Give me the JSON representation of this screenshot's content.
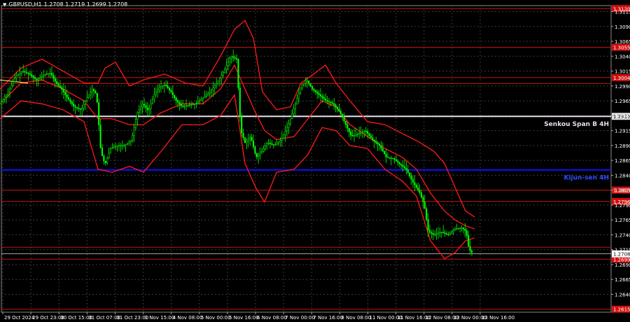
{
  "header": {
    "symbol_label": "GBPUSD,H1",
    "ohlc": "1.2708 1.2719 1.2699 1.2708"
  },
  "colors": {
    "background": "#000000",
    "grid": "#3a3a3a",
    "candle_bull": "#00ff00",
    "candle_bear": "#00ff00",
    "band": "#ff1a1a",
    "level_red": "#c0170b",
    "senkou": "#e6dde6",
    "kijun": "#1010ff",
    "price_line": "#ffffff",
    "axis_text": "#ffffff"
  },
  "chart_data": {
    "type": "candlestick",
    "title": "GBPUSD,H1",
    "ylim": [
      1.261,
      1.3125
    ],
    "y_ticks": [
      "1.3115",
      "1.3090",
      "1.3065",
      "1.3040",
      "1.3015",
      "1.2990",
      "1.2965",
      "1.2940",
      "1.2915",
      "1.2890",
      "1.2865",
      "1.2840",
      "1.2815",
      "1.2790",
      "1.2765",
      "1.2740",
      "1.2715",
      "1.2690",
      "1.2665",
      "1.2640"
    ],
    "x_ticks": [
      "29 Oct 2024",
      "29 Oct 23:00",
      "30 Oct 15:00",
      "31 Oct 07:00",
      "31 Oct 23:00",
      "1 Nov 15:00",
      "4 Nov 08:00",
      "5 Nov 00:00",
      "5 Nov 16:00",
      "6 Nov 08:00",
      "7 Nov 00:00",
      "7 Nov 16:00",
      "8 Nov 08:00",
      "11 Nov 00:00",
      "11 Nov 16:00",
      "12 Nov 08:00",
      "13 Nov 00:00",
      "13 Nov 16:00"
    ],
    "horizontal_levels": [
      {
        "price": 1.312,
        "label": "1.3120",
        "kind": "red"
      },
      {
        "price": 1.3055,
        "label": "1.3055",
        "kind": "red"
      },
      {
        "price": 1.3004,
        "label": "1.3004",
        "kind": "red"
      },
      {
        "price": 1.2994,
        "label": "",
        "kind": "red"
      },
      {
        "price": 1.2939,
        "label": "1.2939",
        "kind": "senkou",
        "name": "Senkou Span B 4H"
      },
      {
        "price": 1.2849,
        "label": "",
        "kind": "kijun",
        "name": "Kijun-sen 4H"
      },
      {
        "price": 1.2815,
        "label": "1.2815",
        "kind": "red"
      },
      {
        "price": 1.2796,
        "label": "1.2796",
        "kind": "red"
      },
      {
        "price": 1.2719,
        "label": "",
        "kind": "red"
      },
      {
        "price": 1.2699,
        "label": "1.2699",
        "kind": "red"
      },
      {
        "price": 1.2615,
        "label": "1.2615",
        "kind": "red"
      }
    ],
    "current_price": {
      "price": 1.2708,
      "label": "1.2708"
    },
    "price_path": [
      [
        0,
        1.296
      ],
      [
        12,
        1.298
      ],
      [
        22,
        1.3005
      ],
      [
        32,
        1.3015
      ],
      [
        42,
        1.301
      ],
      [
        52,
        1.3
      ],
      [
        62,
        1.3008
      ],
      [
        72,
        1.3012
      ],
      [
        80,
        1.2995
      ],
      [
        88,
        1.2985
      ],
      [
        96,
        1.297
      ],
      [
        106,
        1.2955
      ],
      [
        116,
        1.295
      ],
      [
        124,
        1.297
      ],
      [
        132,
        1.2985
      ],
      [
        138,
        1.2975
      ],
      [
        144,
        1.288
      ],
      [
        150,
        1.2858
      ],
      [
        158,
        1.2885
      ],
      [
        168,
        1.289
      ],
      [
        178,
        1.289
      ],
      [
        188,
        1.29
      ],
      [
        196,
        1.2945
      ],
      [
        204,
        1.296
      ],
      [
        212,
        1.2948
      ],
      [
        220,
        1.2975
      ],
      [
        228,
        1.2988
      ],
      [
        236,
        1.2992
      ],
      [
        244,
        1.298
      ],
      [
        252,
        1.2965
      ],
      [
        260,
        1.2955
      ],
      [
        270,
        1.2958
      ],
      [
        280,
        1.296
      ],
      [
        290,
        1.297
      ],
      [
        300,
        1.298
      ],
      [
        310,
        1.2995
      ],
      [
        320,
        1.3015
      ],
      [
        330,
        1.304
      ],
      [
        338,
        1.3035
      ],
      [
        344,
        1.2915
      ],
      [
        350,
        1.2895
      ],
      [
        358,
        1.2905
      ],
      [
        366,
        1.287
      ],
      [
        374,
        1.288
      ],
      [
        382,
        1.2895
      ],
      [
        392,
        1.289
      ],
      [
        402,
        1.29
      ],
      [
        412,
        1.2925
      ],
      [
        422,
        1.296
      ],
      [
        430,
        1.299
      ],
      [
        438,
        1.3
      ],
      [
        446,
        1.2985
      ],
      [
        456,
        1.2975
      ],
      [
        466,
        1.2965
      ],
      [
        476,
        1.296
      ],
      [
        486,
        1.2945
      ],
      [
        494,
        1.2925
      ],
      [
        502,
        1.2905
      ],
      [
        512,
        1.291
      ],
      [
        522,
        1.2915
      ],
      [
        532,
        1.29
      ],
      [
        542,
        1.289
      ],
      [
        552,
        1.287
      ],
      [
        562,
        1.2868
      ],
      [
        572,
        1.2858
      ],
      [
        580,
        1.285
      ],
      [
        590,
        1.2828
      ],
      [
        600,
        1.281
      ],
      [
        606,
        1.279
      ],
      [
        612,
        1.2745
      ],
      [
        620,
        1.274
      ],
      [
        630,
        1.2745
      ],
      [
        640,
        1.274
      ],
      [
        650,
        1.275
      ],
      [
        660,
        1.2752
      ],
      [
        666,
        1.2745
      ],
      [
        670,
        1.2715
      ],
      [
        676,
        1.2708
      ]
    ],
    "upper_band": [
      [
        0,
        1.2985
      ],
      [
        30,
        1.302
      ],
      [
        60,
        1.3035
      ],
      [
        90,
        1.3015
      ],
      [
        120,
        1.2995
      ],
      [
        140,
        1.2995
      ],
      [
        150,
        1.302
      ],
      [
        165,
        1.303
      ],
      [
        185,
        1.299
      ],
      [
        205,
        1.3
      ],
      [
        235,
        1.301
      ],
      [
        265,
        1.2995
      ],
      [
        290,
        1.299
      ],
      [
        315,
        1.304
      ],
      [
        335,
        1.3085
      ],
      [
        350,
        1.31
      ],
      [
        362,
        1.307
      ],
      [
        375,
        1.298
      ],
      [
        395,
        1.295
      ],
      [
        415,
        1.2955
      ],
      [
        430,
        1.2995
      ],
      [
        448,
        1.301
      ],
      [
        465,
        1.3025
      ],
      [
        480,
        1.2995
      ],
      [
        500,
        1.2965
      ],
      [
        525,
        1.293
      ],
      [
        550,
        1.2925
      ],
      [
        575,
        1.291
      ],
      [
        600,
        1.2895
      ],
      [
        620,
        1.288
      ],
      [
        635,
        1.286
      ],
      [
        650,
        1.282
      ],
      [
        665,
        1.278
      ],
      [
        678,
        1.277
      ]
    ],
    "lower_band": [
      [
        0,
        1.2935
      ],
      [
        30,
        1.2965
      ],
      [
        60,
        1.296
      ],
      [
        90,
        1.295
      ],
      [
        120,
        1.293
      ],
      [
        140,
        1.285
      ],
      [
        160,
        1.2845
      ],
      [
        185,
        1.2855
      ],
      [
        205,
        1.2845
      ],
      [
        230,
        1.288
      ],
      [
        260,
        1.2925
      ],
      [
        290,
        1.2925
      ],
      [
        315,
        1.294
      ],
      [
        335,
        1.2975
      ],
      [
        350,
        1.286
      ],
      [
        365,
        1.282
      ],
      [
        378,
        1.2795
      ],
      [
        395,
        1.2845
      ],
      [
        420,
        1.285
      ],
      [
        440,
        1.2875
      ],
      [
        460,
        1.292
      ],
      [
        480,
        1.2915
      ],
      [
        500,
        1.289
      ],
      [
        525,
        1.2885
      ],
      [
        550,
        1.285
      ],
      [
        575,
        1.283
      ],
      [
        595,
        1.2805
      ],
      [
        615,
        1.273
      ],
      [
        635,
        1.27
      ],
      [
        650,
        1.271
      ],
      [
        665,
        1.273
      ],
      [
        678,
        1.2735
      ]
    ],
    "middle_line": [
      [
        0,
        1.296
      ],
      [
        30,
        1.2995
      ],
      [
        60,
        1.3
      ],
      [
        90,
        1.2985
      ],
      [
        120,
        1.2965
      ],
      [
        140,
        1.2935
      ],
      [
        160,
        1.2935
      ],
      [
        185,
        1.2925
      ],
      [
        205,
        1.2925
      ],
      [
        230,
        1.2945
      ],
      [
        260,
        1.296
      ],
      [
        290,
        1.296
      ],
      [
        315,
        1.2985
      ],
      [
        335,
        1.3025
      ],
      [
        350,
        1.2985
      ],
      [
        365,
        1.2945
      ],
      [
        378,
        1.2915
      ],
      [
        395,
        1.29
      ],
      [
        420,
        1.2905
      ],
      [
        440,
        1.2935
      ],
      [
        460,
        1.2965
      ],
      [
        480,
        1.2955
      ],
      [
        500,
        1.2925
      ],
      [
        525,
        1.2905
      ],
      [
        550,
        1.2885
      ],
      [
        575,
        1.287
      ],
      [
        595,
        1.285
      ],
      [
        615,
        1.281
      ],
      [
        635,
        1.278
      ],
      [
        650,
        1.2765
      ],
      [
        665,
        1.2755
      ],
      [
        678,
        1.275
      ]
    ],
    "tenkan_fragment": [
      [
        0,
        1.3
      ],
      [
        40,
        1.2995
      ]
    ]
  }
}
